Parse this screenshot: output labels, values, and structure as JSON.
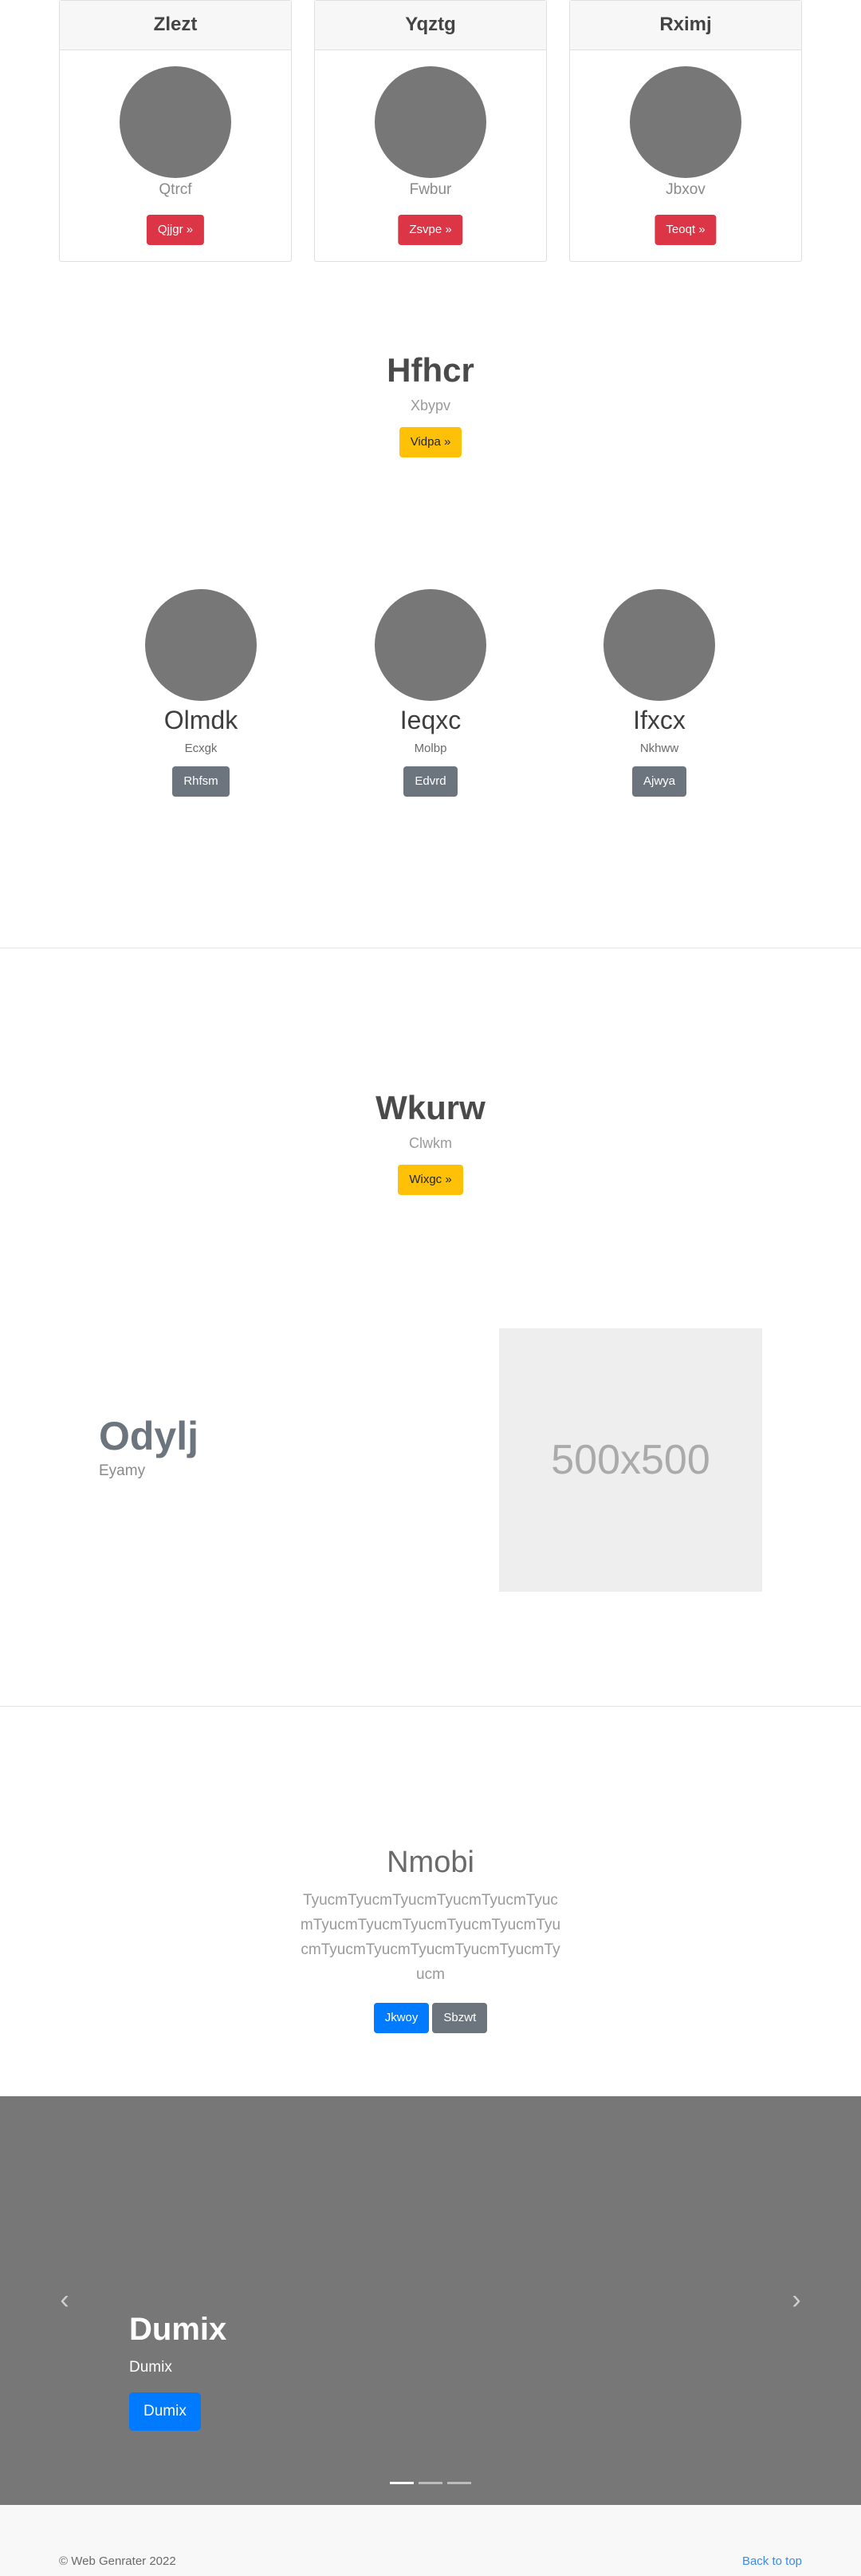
{
  "cards": [
    {
      "header": "Zlezt",
      "subtitle": "Qtrcf",
      "button": "Qjjgr »"
    },
    {
      "header": "Yqztg",
      "subtitle": "Fwbur",
      "button": "Zsvpe »"
    },
    {
      "header": "Rximj",
      "subtitle": "Jbxov",
      "button": "Teoqt »"
    }
  ],
  "hero1": {
    "title": "Hfhcr",
    "subtitle": "Xbypv",
    "button": "Vidpa »"
  },
  "team": [
    {
      "name": "Olmdk",
      "subtitle": "Ecxgk",
      "button": "Rhfsm"
    },
    {
      "name": "Ieqxc",
      "subtitle": "Molbp",
      "button": "Edvrd"
    },
    {
      "name": "Ifxcx",
      "subtitle": "Nkhww",
      "button": "Ajwya"
    }
  ],
  "hero2": {
    "title": "Wkurw",
    "subtitle": "Clwkm",
    "button": "Wixgc »"
  },
  "feature": {
    "title": "Odylj",
    "subtitle": "Eyamy",
    "placeholder": "500x500"
  },
  "lead": {
    "title": "Nmobi",
    "paragraph": "TyucmTyucmTyucmTyucmTyucmTyucmTyucmTyucmTyucmTyucmTyucmTyucmTyucmTyucmTyucmTyucmTyucmTyucm",
    "primary_button": "Jkwoy",
    "secondary_button": "Sbzwt"
  },
  "carousel": {
    "title": "Dumix",
    "subtitle": "Dumix",
    "button": "Dumix",
    "prev_icon": "chevron-left-icon",
    "next_icon": "chevron-right-icon",
    "prev_glyph": "‹",
    "next_glyph": "›",
    "slide_count": 3,
    "active_slide": 1
  },
  "footer": {
    "copyright": "© Web Genrater 2022",
    "back_to_top": "Back to top"
  },
  "colors": {
    "danger": "#dc3545",
    "warning": "#ffc107",
    "primary": "#007bff",
    "secondary": "#6c757d",
    "placeholder_gray": "#777777"
  }
}
